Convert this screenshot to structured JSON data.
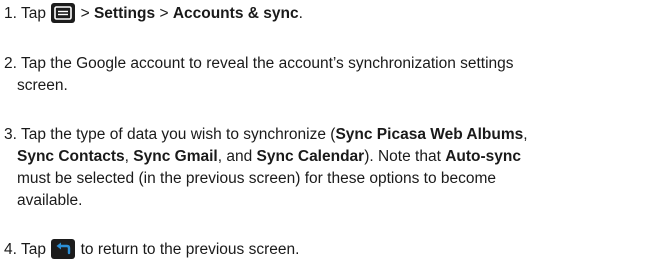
{
  "steps": [
    {
      "num": "1.",
      "tap": "Tap",
      "icon": "menu-icon",
      "sep1": ">",
      "settings": "Settings",
      "sep2": ">",
      "accounts": "Accounts & sync",
      "end": "."
    },
    {
      "num": "2.",
      "line1": "Tap the Google account to reveal the account’s synchronization settings",
      "line2": "screen."
    },
    {
      "num": "3.",
      "l1_a": "Tap the type of data you wish to synchronize (",
      "l1_b": "Sync Picasa Web Albums",
      "l1_c": ",",
      "l2_a": "Sync Contacts",
      "l2_b": ", ",
      "l2_c": "Sync Gmail",
      "l2_d": ", and ",
      "l2_e": "Sync Calendar",
      "l2_f": "). Note that ",
      "l2_g": "Auto-sync",
      "line3": "must be selected (in the previous screen) for these options to become",
      "line4": "available."
    },
    {
      "num": "4.",
      "tap": "Tap",
      "icon": "back-icon",
      "rest": "to return to the previous screen."
    }
  ],
  "colors": {
    "text": "#1a1a1a",
    "icon_bg": "#1c1c1c",
    "back_arrow": "#2c8fd6"
  }
}
